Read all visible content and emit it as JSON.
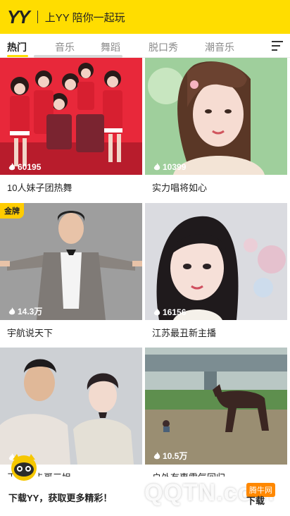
{
  "header": {
    "logo": "YY",
    "slogan": "上YY 陪你一起玩",
    "bg_color": "#ffdd00"
  },
  "tabs": [
    {
      "label": "热门",
      "active": true
    },
    {
      "label": "音乐",
      "active": false
    },
    {
      "label": "舞蹈",
      "active": false
    },
    {
      "label": "脱口秀",
      "active": false
    },
    {
      "label": "潮音乐",
      "active": false
    }
  ],
  "menu_icon": "menu-icon",
  "cards": [
    {
      "count": "60195",
      "caption": "10人妹子团热舞"
    },
    {
      "count": "10399",
      "caption": "实力唱将如心"
    },
    {
      "count": "14.3万",
      "caption": "宇航说天下",
      "badge": "金牌"
    },
    {
      "count": "16156",
      "caption": "江苏最丑新主播"
    },
    {
      "count": "",
      "caption": "王一寿卡哥三姐"
    },
    {
      "count": "10.5万",
      "caption": "户外有惠需气回归"
    }
  ],
  "download_bar": {
    "text": "下载YY，获取更多精彩！",
    "button": "下载"
  },
  "watermark": {
    "text": "QQTN.com",
    "tag": "腾牛网"
  }
}
